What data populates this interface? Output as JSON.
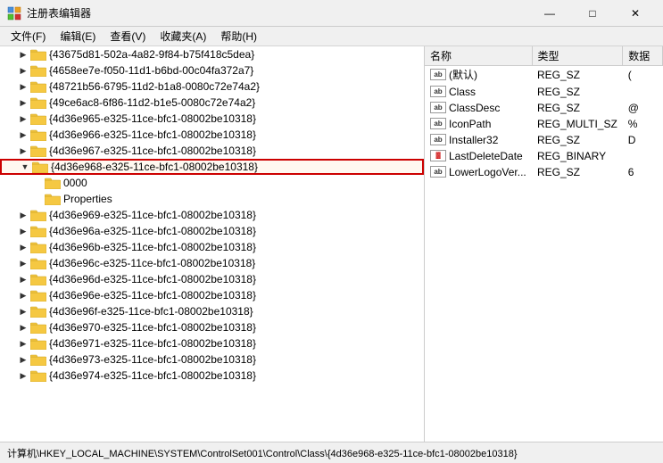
{
  "titleBar": {
    "icon": "registry-editor-icon",
    "title": "注册表编辑器",
    "minimizeLabel": "—",
    "maximizeLabel": "□",
    "closeLabel": "✕"
  },
  "menuBar": {
    "items": [
      {
        "label": "文件(F)"
      },
      {
        "label": "编辑(E)"
      },
      {
        "label": "查看(V)"
      },
      {
        "label": "收藏夹(A)"
      },
      {
        "label": "帮助(H)"
      }
    ]
  },
  "treePanel": {
    "items": [
      {
        "id": "item1",
        "indent": 1,
        "expanded": false,
        "label": "{43675d81-502a-4a82-9f84-b75f418c5dea}",
        "selected": false,
        "highlighted": false
      },
      {
        "id": "item2",
        "indent": 1,
        "expanded": false,
        "label": "{4658ee7e-f050-11d1-b6bd-00c04fa372a7}",
        "selected": false,
        "highlighted": false
      },
      {
        "id": "item3",
        "indent": 1,
        "expanded": false,
        "label": "{48721b56-6795-11d2-b1a8-0080c72e74a2}",
        "selected": false,
        "highlighted": false
      },
      {
        "id": "item4",
        "indent": 1,
        "expanded": false,
        "label": "{49ce6ac8-6f86-11d2-b1e5-0080c72e74a2}",
        "selected": false,
        "highlighted": false
      },
      {
        "id": "item5",
        "indent": 1,
        "expanded": false,
        "label": "{4d36e965-e325-11ce-bfc1-08002be10318}",
        "selected": false,
        "highlighted": false
      },
      {
        "id": "item6",
        "indent": 1,
        "expanded": false,
        "label": "{4d36e966-e325-11ce-bfc1-08002be10318}",
        "selected": false,
        "highlighted": false
      },
      {
        "id": "item7",
        "indent": 1,
        "expanded": false,
        "label": "{4d36e967-e325-11ce-bfc1-08002be10318}",
        "selected": false,
        "highlighted": false
      },
      {
        "id": "item8",
        "indent": 1,
        "expanded": true,
        "label": "{4d36e968-e325-11ce-bfc1-08002be10318}",
        "selected": false,
        "highlighted": true
      },
      {
        "id": "item8a",
        "indent": 2,
        "expanded": false,
        "label": "0000",
        "selected": false,
        "highlighted": false
      },
      {
        "id": "item8b",
        "indent": 2,
        "expanded": false,
        "label": "Properties",
        "selected": false,
        "highlighted": false
      },
      {
        "id": "item9",
        "indent": 1,
        "expanded": false,
        "label": "{4d36e969-e325-11ce-bfc1-08002be10318}",
        "selected": false,
        "highlighted": false
      },
      {
        "id": "item10",
        "indent": 1,
        "expanded": false,
        "label": "{4d36e96a-e325-11ce-bfc1-08002be10318}",
        "selected": false,
        "highlighted": false
      },
      {
        "id": "item11",
        "indent": 1,
        "expanded": false,
        "label": "{4d36e96b-e325-11ce-bfc1-08002be10318}",
        "selected": false,
        "highlighted": false
      },
      {
        "id": "item12",
        "indent": 1,
        "expanded": false,
        "label": "{4d36e96c-e325-11ce-bfc1-08002be10318}",
        "selected": false,
        "highlighted": false
      },
      {
        "id": "item13",
        "indent": 1,
        "expanded": false,
        "label": "{4d36e96d-e325-11ce-bfc1-08002be10318}",
        "selected": false,
        "highlighted": false
      },
      {
        "id": "item14",
        "indent": 1,
        "expanded": false,
        "label": "{4d36e96e-e325-11ce-bfc1-08002be10318}",
        "selected": false,
        "highlighted": false
      },
      {
        "id": "item15",
        "indent": 1,
        "expanded": false,
        "label": "{4d36e96f-e325-11ce-bfc1-08002be10318}",
        "selected": false,
        "highlighted": false
      },
      {
        "id": "item16",
        "indent": 1,
        "expanded": false,
        "label": "{4d36e970-e325-11ce-bfc1-08002be10318}",
        "selected": false,
        "highlighted": false
      },
      {
        "id": "item17",
        "indent": 1,
        "expanded": false,
        "label": "{4d36e971-e325-11ce-bfc1-08002be10318}",
        "selected": false,
        "highlighted": false
      },
      {
        "id": "item18",
        "indent": 1,
        "expanded": false,
        "label": "{4d36e973-e325-11ce-bfc1-08002be10318}",
        "selected": false,
        "highlighted": false
      },
      {
        "id": "item19",
        "indent": 1,
        "expanded": false,
        "label": "{4d36e974-e325-11ce-bfc1-08002be10318}",
        "selected": false,
        "highlighted": false
      }
    ]
  },
  "rightPanel": {
    "columns": {
      "name": "名称",
      "type": "类型",
      "data": "数据"
    },
    "rows": [
      {
        "name": "(默认)",
        "typeIcon": "ab",
        "type": "REG_SZ",
        "data": "("
      },
      {
        "name": "Class",
        "typeIcon": "ab",
        "type": "REG_SZ",
        "data": ""
      },
      {
        "name": "ClassDesc",
        "typeIcon": "ab",
        "type": "REG_SZ",
        "data": "@"
      },
      {
        "name": "IconPath",
        "typeIcon": "ab",
        "type": "REG_MULTI_SZ",
        "data": "%"
      },
      {
        "name": "Installer32",
        "typeIcon": "ab",
        "type": "REG_SZ",
        "data": "D"
      },
      {
        "name": "LastDeleteDate",
        "typeIcon": "binary",
        "type": "REG_BINARY",
        "data": ""
      },
      {
        "name": "LowerLogoVer...",
        "typeIcon": "ab",
        "type": "REG_SZ",
        "data": "6"
      }
    ]
  },
  "statusBar": {
    "text": "计算机\\HKEY_LOCAL_MACHINE\\SYSTEM\\ControlSet001\\Control\\Class\\{4d36e968-e325-11ce-bfc1-08002be10318}"
  }
}
